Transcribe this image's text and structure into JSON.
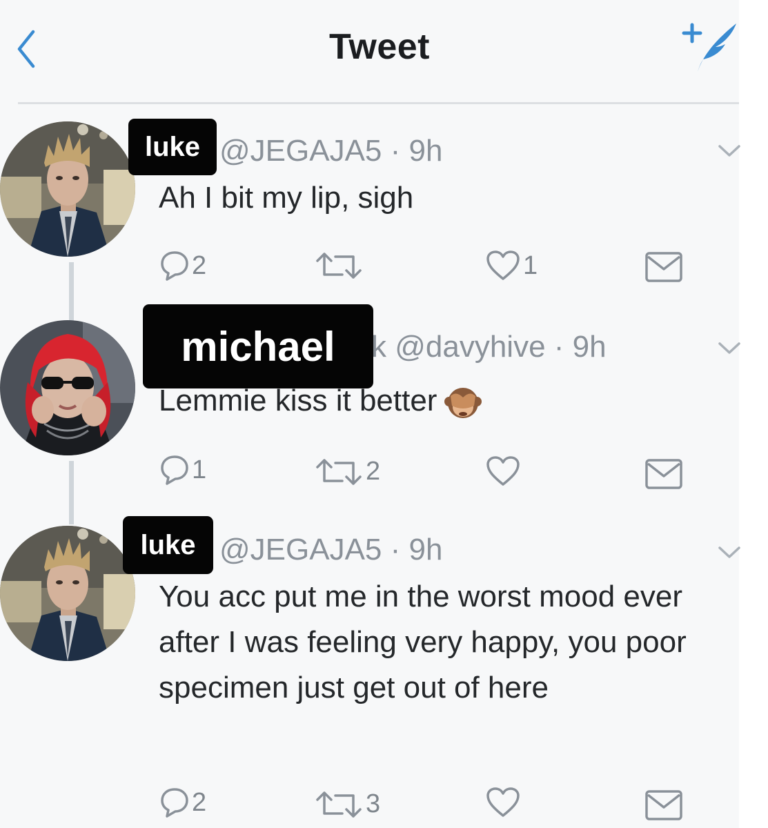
{
  "header": {
    "title": "Tweet",
    "back_icon": "chevron-left-icon",
    "compose_icon": "compose-tweet-icon",
    "accent_color": "#3a8bd1"
  },
  "tweets": [
    {
      "label": "luke",
      "handle_line": "@JEGAJA5 · 9h",
      "body": "Ah I bit my lip, sigh",
      "replies": "2",
      "retweets": "",
      "likes": "1"
    },
    {
      "label": "michael",
      "handle_line": "k @davyhive · 9h",
      "body": "Lemmie kiss it better",
      "emoji": "see-no-evil-monkey-emoji",
      "replies": "1",
      "retweets": "2",
      "likes": ""
    },
    {
      "label": "luke",
      "handle_line": "@JEGAJA5 · 9h",
      "body": "You acc put me in the worst mood ever after I was feeling very happy, you poor specimen just get out of here",
      "replies": "2",
      "retweets": "3",
      "likes": ""
    }
  ]
}
